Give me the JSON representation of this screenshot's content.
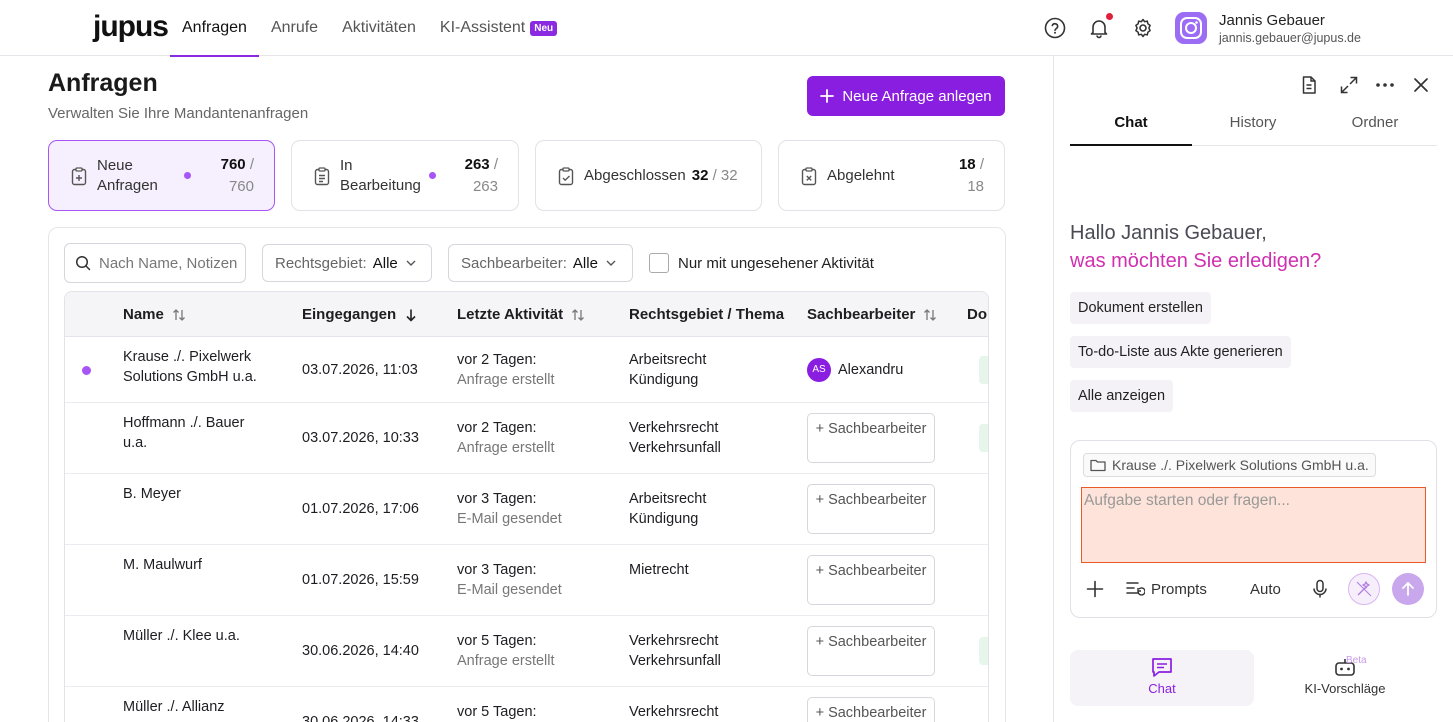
{
  "app": {
    "logo": "jupus"
  },
  "nav": {
    "items": [
      "Anfragen",
      "Anrufe",
      "Aktivitäten",
      "KI-Assistent"
    ],
    "new_badge": "Neu",
    "active": "Anfragen"
  },
  "user": {
    "name": "Jannis Gebauer",
    "email": "jannis.gebauer@jupus.de"
  },
  "page": {
    "title": "Anfragen",
    "subtitle": "Verwalten Sie Ihre Mandantenanfragen",
    "new_button": "Neue Anfrage anlegen"
  },
  "stats": [
    {
      "label": "Neue Anfragen",
      "count": "760",
      "total": "/ 760",
      "active": true,
      "dot": true
    },
    {
      "label": "In Bearbeitung",
      "count": "263",
      "total": "/ 263",
      "active": false,
      "dot": true
    },
    {
      "label": "Abgeschlossen",
      "count": "32",
      "total": "/ 32",
      "active": false,
      "dot": false
    },
    {
      "label": "Abgelehnt",
      "count": "18",
      "total": "/ 18",
      "active": false,
      "dot": false
    }
  ],
  "filters": {
    "search_placeholder": "Nach Name, Notizen",
    "rechtsgebiet_label": "Rechtsgebiet:",
    "rechtsgebiet_value": "Alle",
    "sachbearbeiter_label": "Sachbearbeiter:",
    "sachbearbeiter_value": "Alle",
    "unread_only": "Nur mit ungesehener Aktivität"
  },
  "table": {
    "columns": [
      "Name",
      "Eingegangen",
      "Letzte Aktivität",
      "Rechtsgebiet / Thema",
      "Sachbearbeiter",
      "Dol"
    ],
    "assign_label": "+ Sachbearbeiter",
    "rows": [
      {
        "name": "Krause ./. Pixelwerk Solutions GmbH u.a.",
        "received": "03.07.2026, 11:03",
        "activity_when": "vor 2 Tagen:",
        "activity_what": "Anfrage erstellt",
        "area": "Arbeitsrecht",
        "topic": "Kündigung",
        "assignee": "Alexandru",
        "assignee_initials": "AS",
        "unread": true
      },
      {
        "name": "Hoffmann ./. Bauer u.a.",
        "received": "03.07.2026, 10:33",
        "activity_when": "vor 2 Tagen:",
        "activity_what": "Anfrage erstellt",
        "area": "Verkehrsrecht",
        "topic": "Verkehrsunfall",
        "assignee": "",
        "unread": false
      },
      {
        "name": "B. Meyer",
        "received": "01.07.2026, 17:06",
        "activity_when": "vor 3 Tagen:",
        "activity_what": "E-Mail gesendet",
        "area": "Arbeitsrecht",
        "topic": "Kündigung",
        "assignee": "",
        "unread": false
      },
      {
        "name": "M. Maulwurf",
        "received": "01.07.2026, 15:59",
        "activity_when": "vor 3 Tagen:",
        "activity_what": "E-Mail gesendet",
        "area": "Mietrecht",
        "topic": "",
        "assignee": "",
        "unread": false
      },
      {
        "name": "Müller ./. Klee u.a.",
        "received": "30.06.2026, 14:40",
        "activity_when": "vor 5 Tagen:",
        "activity_what": "Anfrage erstellt",
        "area": "Verkehrsrecht",
        "topic": "Verkehrsunfall",
        "assignee": "",
        "unread": false
      },
      {
        "name": "Müller ./. Allianz",
        "received": "30.06.2026, 14:33",
        "activity_when": "vor 5 Tagen:",
        "activity_what": "",
        "area": "Verkehrsrecht",
        "topic": "",
        "assignee": "",
        "unread": false
      }
    ]
  },
  "assistant": {
    "tabs": [
      "Chat",
      "History",
      "Ordner"
    ],
    "active_tab": "Chat",
    "greeting_line1": "Hallo Jannis Gebauer,",
    "greeting_line2": "was möchten Sie erledigen?",
    "suggestions": [
      "Dokument erstellen",
      "To-do-Liste aus Akte generieren",
      "Alle anzeigen"
    ],
    "context_chip": "Krause ./. Pixelwerk Solutions GmbH u.a.",
    "input_placeholder": "Aufgabe starten oder fragen...",
    "prompts_label": "Prompts",
    "mode_label": "Auto",
    "bottom_tabs": [
      "Chat",
      "KI-Vorschläge"
    ],
    "beta_badge": "Beta"
  },
  "colors": {
    "accent": "#8a1ee0",
    "accent_light": "#a855f7",
    "greeting_accent": "#d030b0",
    "input_highlight": "#e85a2a"
  }
}
